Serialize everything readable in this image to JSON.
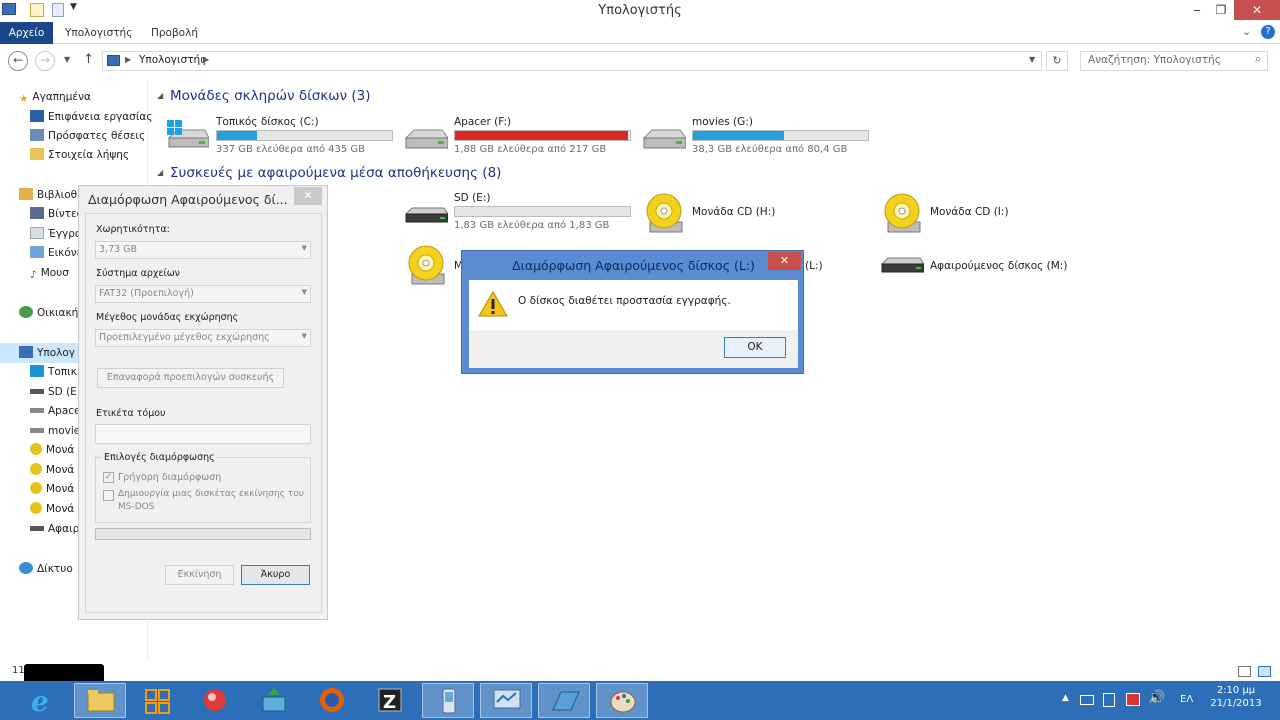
{
  "window": {
    "title": "Υπολογιστής",
    "controls": {
      "minimize": "‒",
      "maximize": "❐",
      "close": "✕"
    }
  },
  "ribbon": {
    "tabs": [
      "Αρχείο",
      "Υπολογιστής",
      "Προβολή"
    ]
  },
  "address": {
    "path": "Υπολογιστής",
    "search_placeholder": "Αναζήτηση: Υπολογιστής"
  },
  "nav": {
    "favorites": {
      "label": "Αγαπημένα",
      "items": [
        "Επιφάνεια εργασίας",
        "Πρόσφατες θέσεις",
        "Στοιχεία λήψης"
      ]
    },
    "libraries": {
      "label": "Βιβλιοθ",
      "items": [
        "Βίντεο",
        "Έγγρο",
        "Εικόνε",
        "Μουσ"
      ]
    },
    "homegroup": "Οικιακή",
    "computer": {
      "label": "Υπολογ",
      "items": [
        "Τοπικ",
        "SD (E:)",
        "Apace",
        "movie",
        "Μονά",
        "Μονά",
        "Μονά",
        "Μονά",
        "Αφαιρ"
      ]
    },
    "network": "Δίκτυο"
  },
  "content": {
    "hdd_group": "Μονάδες σκληρών δίσκων (3)",
    "removable_group": "Συσκευές με αφαιρούμενα μέσα αποθήκευσης (8)",
    "drives": [
      {
        "name": "Τοπικός δίσκος (C:)",
        "free_text": "337 GB ελεύθερα από 435 GB",
        "used_fraction": 0.23,
        "bar_color": "#26a0da"
      },
      {
        "name": "Apacer (F:)",
        "free_text": "1,88 GB ελεύθερα από 217 GB",
        "used_fraction": 0.99,
        "bar_color": "#da2626"
      },
      {
        "name": "movies (G:)",
        "free_text": "38,3 GB ελεύθερα από 80,4 GB",
        "used_fraction": 0.52,
        "bar_color": "#26a0da"
      }
    ],
    "removable": [
      {
        "name": "SD (E:)",
        "free_text": "1,83 GB ελεύθερα από 1,83 GB",
        "used_fraction": 0.0
      },
      {
        "name": "Μονάδα CD (H:)"
      },
      {
        "name": "Μονάδα CD (I:)"
      },
      {
        "name": "M"
      },
      {
        "name": "(L:)"
      },
      {
        "name": "Αφαιρούμενος δίσκος (M:)"
      }
    ],
    "status_count": "11"
  },
  "format_dialog": {
    "title": "Διαμόρφωση Αφαιρούμενος δί...",
    "capacity_label": "Χωρητικότητα:",
    "capacity_value": "3,73 GB",
    "fs_label": "Σύστημα αρχείων",
    "fs_value": "FAT32 (Προεπιλογή)",
    "alloc_label": "Μέγεθος μονάδας εκχώρησης",
    "alloc_value": "Προεπιλεγμένο μέγεθος εκχώρησης",
    "restore_button": "Επαναφορά προεπιλογών συσκευής",
    "volume_label": "Ετικέτα τόμου",
    "options_label": "Επιλογές διαμόρφωσης",
    "quick_format": "Γρήγορη διαμόρφωση",
    "msdos_line1": "Δημιουργία μιας δισκέτας εκκίνησης του",
    "msdos_line2": "MS-DOS",
    "start_button": "Εκκίνηση",
    "cancel_button": "Άκυρο"
  },
  "message_box": {
    "title": "Διαμόρφωση Αφαιρούμενος δίσκος (L:)",
    "text": "Ο δίσκος διαθέτει προστασία εγγραφής.",
    "ok_button": "OK"
  },
  "taskbar": {
    "language": "ΕΛ",
    "time": "2:10 μμ",
    "date": "21/1/2013"
  }
}
